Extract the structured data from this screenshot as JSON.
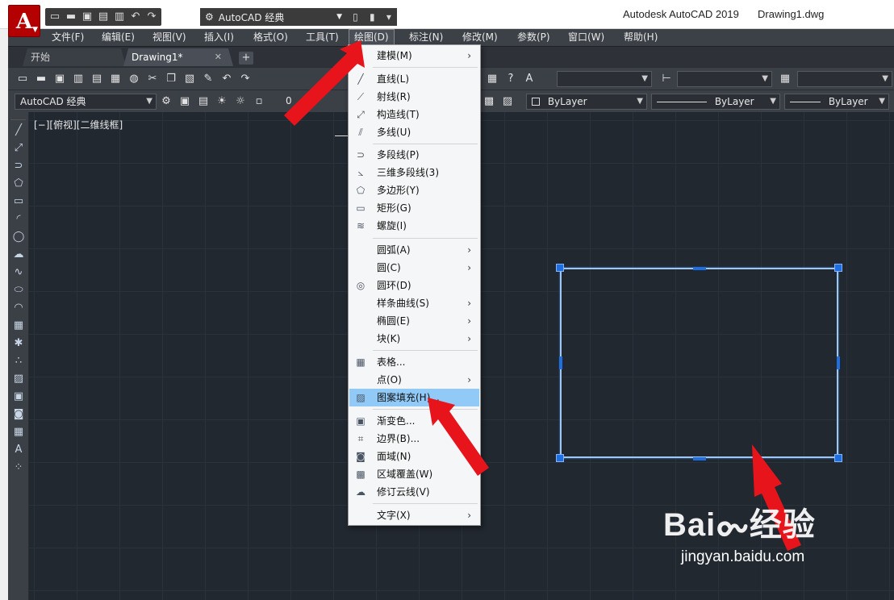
{
  "app": {
    "logo_letter": "A",
    "title": "Autodesk AutoCAD 2019",
    "document": "Drawing1.dwg",
    "workspace": "AutoCAD 经典"
  },
  "menubar": {
    "items": [
      "文件(F)",
      "编辑(E)",
      "视图(V)",
      "插入(I)",
      "格式(O)",
      "工具(T)",
      "绘图(D)",
      "标注(N)",
      "修改(M)",
      "参数(P)",
      "窗口(W)",
      "帮助(H)"
    ],
    "active": "绘图(D)"
  },
  "tabs": {
    "start": "开始",
    "drawing": "Drawing1*",
    "close_glyph": "✕",
    "add_glyph": "+"
  },
  "toolbar2": {
    "workspace_combo": "AutoCAD 经典",
    "layer_value": "0",
    "color_combo": "ByLayer",
    "linetype_combo": "ByLayer",
    "lineweight_combo": "ByLayer"
  },
  "viewport": {
    "label": "[−][俯视][二维线框]"
  },
  "draw_menu": {
    "items": [
      {
        "label": "建模(M)",
        "icon": "none",
        "submenu": true
      },
      {
        "label": "直线(L)",
        "icon": "line-icon",
        "submenu": false
      },
      {
        "label": "射线(R)",
        "icon": "ray-icon",
        "submenu": false
      },
      {
        "label": "构造线(T)",
        "icon": "xline-icon",
        "submenu": false
      },
      {
        "label": "多线(U)",
        "icon": "mline-icon",
        "submenu": false
      },
      {
        "label": "多段线(P)",
        "icon": "polyline-icon",
        "submenu": false
      },
      {
        "label": "三维多段线(3)",
        "icon": "3dpoly-icon",
        "submenu": false
      },
      {
        "label": "多边形(Y)",
        "icon": "polygon-icon",
        "submenu": false
      },
      {
        "label": "矩形(G)",
        "icon": "rectangle-icon",
        "submenu": false
      },
      {
        "label": "螺旋(I)",
        "icon": "helix-icon",
        "submenu": false
      },
      {
        "label": "圆弧(A)",
        "icon": "none",
        "submenu": true
      },
      {
        "label": "圆(C)",
        "icon": "none",
        "submenu": true
      },
      {
        "label": "圆环(D)",
        "icon": "donut-icon",
        "submenu": false
      },
      {
        "label": "样条曲线(S)",
        "icon": "none",
        "submenu": true
      },
      {
        "label": "椭圆(E)",
        "icon": "none",
        "submenu": true
      },
      {
        "label": "块(K)",
        "icon": "none",
        "submenu": true
      },
      {
        "label": "表格...",
        "icon": "table-icon",
        "submenu": false
      },
      {
        "label": "点(O)",
        "icon": "none",
        "submenu": true
      },
      {
        "label": "图案填充(H)...",
        "icon": "hatch-icon",
        "submenu": false
      },
      {
        "label": "渐变色...",
        "icon": "gradient-icon",
        "submenu": false
      },
      {
        "label": "边界(B)...",
        "icon": "boundary-icon",
        "submenu": false
      },
      {
        "label": "面域(N)",
        "icon": "region-icon",
        "submenu": false
      },
      {
        "label": "区域覆盖(W)",
        "icon": "wipeout-icon",
        "submenu": false
      },
      {
        "label": "修订云线(V)",
        "icon": "revcloud-icon",
        "submenu": false
      },
      {
        "label": "文字(X)",
        "icon": "none",
        "submenu": true
      }
    ],
    "highlighted": "图案填充(H)...",
    "submenu_glyph": "›"
  },
  "colors": {
    "canvas_bg": "#212830",
    "menubar_bg": "#3c4047",
    "menu_highlight": "#91c9f7",
    "selection_blue": "#1f6fe0",
    "arrow_red": "#e8141c"
  },
  "watermark": {
    "brand": "Baiᯡ经验",
    "url": "jingyan.baidu.com"
  }
}
